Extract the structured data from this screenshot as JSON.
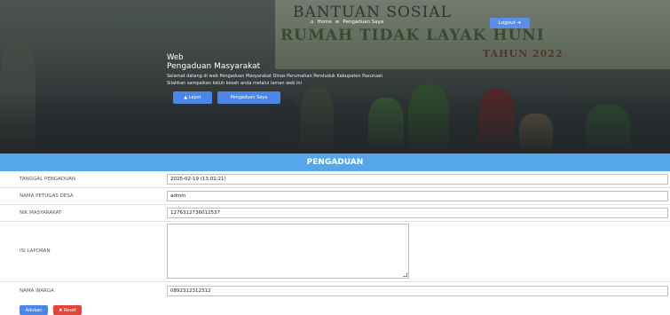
{
  "hero": {
    "banner_line1": "BANTUAN SOSIAL",
    "banner_line2": "RUMAH TIDAK LAYAK HUNI",
    "banner_year": "TAHUN 2022",
    "nav_home_icon": "home-icon",
    "nav_home": "Home",
    "nav_list_icon": "list-icon",
    "nav_complaints": "Pengaduan Saya",
    "login_label": "Logout ➔",
    "title_small": "Web",
    "title_main": "Pengaduan Masyarakat",
    "subtitle_line1": "Selamat datang di web Pengaduan Masyarakat Dinas Perumahan Penduduk Kabupaten Pasuruan",
    "subtitle_line2": "Silahkan sampaikan keluh kesah anda melalui laman web ini",
    "btn_primary_label": "▲ Lapor",
    "btn_secondary_label": "Pengaduan Saya"
  },
  "form": {
    "section_title": "PENGADUAN",
    "rows": [
      {
        "label": "TANGGAL PENGADUAN",
        "value": "2025-02-19 (13:01:21)"
      },
      {
        "label": "NAMA PETUGAS DESA",
        "value": "admin"
      },
      {
        "label": "NIK MASYARAKAT",
        "value": "1276312736012537"
      },
      {
        "label": "ISI LAPORAN",
        "value": ""
      },
      {
        "label": "NAMA WARGA",
        "value": "0892312312312"
      }
    ],
    "submit_label": "Adukan",
    "reset_label": "✖ Reset"
  },
  "colors": {
    "accent": "#55a6ea",
    "button_blue": "#4c86e8",
    "button_red": "#e2453c"
  }
}
